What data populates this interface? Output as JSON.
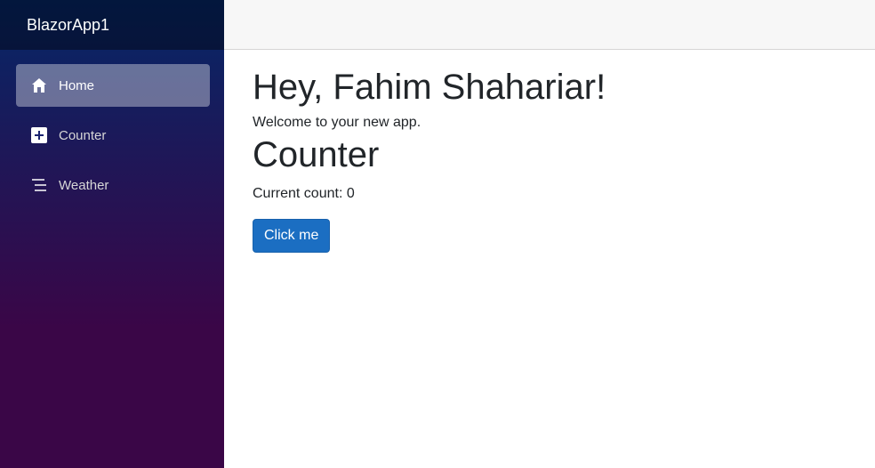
{
  "sidebar": {
    "brand": "BlazorApp1",
    "items": [
      {
        "label": "Home",
        "icon": "home-icon",
        "active": true
      },
      {
        "label": "Counter",
        "icon": "plus-square-icon",
        "active": false
      },
      {
        "label": "Weather",
        "icon": "list-icon",
        "active": false
      }
    ]
  },
  "main": {
    "greeting": "Hey, Fahim Shahariar!",
    "welcome": "Welcome to your new app.",
    "counter_title": "Counter",
    "current_count": "Current count: 0",
    "button_label": "Click me"
  },
  "colors": {
    "sidebar_top": "#052767",
    "sidebar_bottom": "#3a0647",
    "button": "#1b6ec2"
  }
}
